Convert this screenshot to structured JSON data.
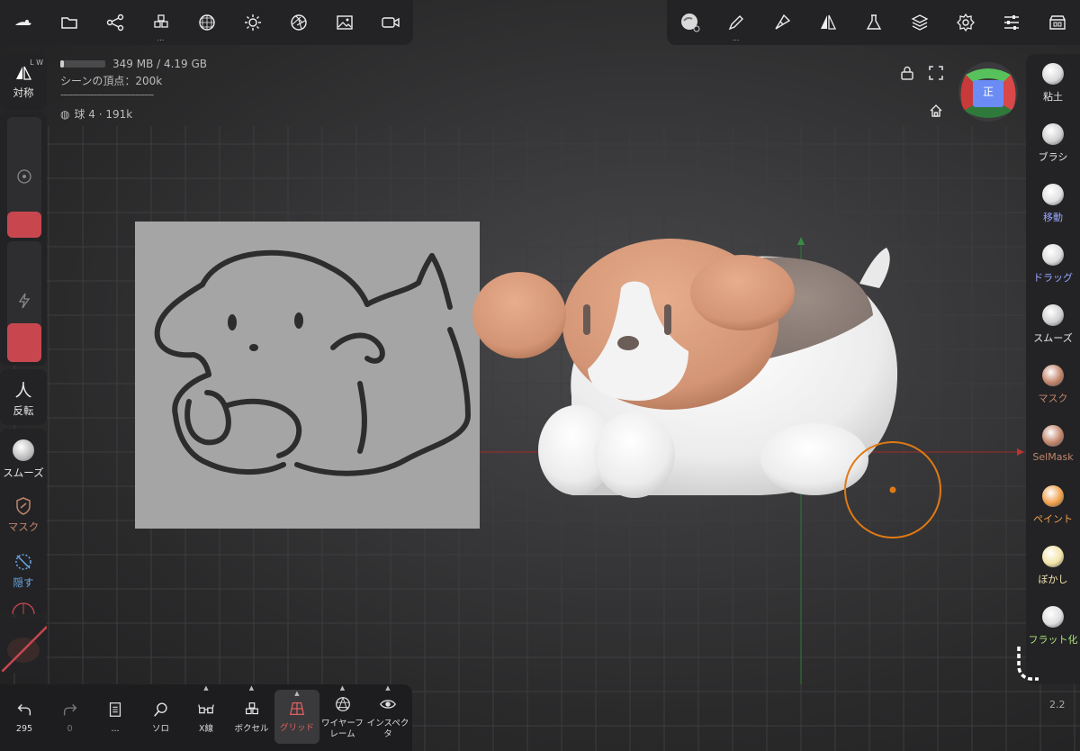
{
  "toolbar_left": [
    {
      "name": "logo-icon"
    },
    {
      "name": "folder-icon"
    },
    {
      "name": "scene-graph-icon"
    },
    {
      "name": "voxel-icon",
      "has_dots": true
    },
    {
      "name": "topology-icon"
    },
    {
      "name": "light-icon"
    },
    {
      "name": "aperture-icon"
    },
    {
      "name": "image-icon"
    },
    {
      "name": "video-icon"
    }
  ],
  "toolbar_right": [
    {
      "name": "material-sphere-icon"
    },
    {
      "name": "pen-icon",
      "has_dots": true
    },
    {
      "name": "brush-icon"
    },
    {
      "name": "symmetry-icon"
    },
    {
      "name": "flask-icon"
    },
    {
      "name": "layers-icon"
    },
    {
      "name": "settings-gear-icon"
    },
    {
      "name": "sliders-icon"
    },
    {
      "name": "shop-icon"
    }
  ],
  "stats": {
    "memory": "349 MB / 4.19 GB",
    "memory_fraction": 0.08,
    "vertices": "シーンの頂点：200k",
    "divider": "-------------------------------",
    "object": "球 4 · 191k"
  },
  "left_panel": {
    "symmetry_label": "対称",
    "symmetry_badge": "L W",
    "radius_fraction": 0.22,
    "intensity_fraction": 0.32,
    "invert_label": "反転",
    "smooth_label": "スムーズ",
    "mask_label": "マスク",
    "hide_label": "隠す"
  },
  "right_panel": [
    {
      "label": "粘土",
      "color": "#e6e6e6",
      "ball": "#d9d9d9"
    },
    {
      "label": "ブラシ",
      "color": "#e6e6e6",
      "ball": "#d0d0d0"
    },
    {
      "label": "移動",
      "color": "#9aa6ff",
      "ball": "#e0e0e0"
    },
    {
      "label": "ドラッグ",
      "color": "#9aa6ff",
      "ball": "#dcdcdc"
    },
    {
      "label": "スムーズ",
      "color": "#e6e6e6",
      "ball": "#cfcfcf"
    },
    {
      "label": "マスク",
      "color": "#c1846a",
      "ball": "#c1846a"
    },
    {
      "label": "SelMask",
      "color": "#c1846a",
      "ball": "#c1846a"
    },
    {
      "label": "ペイント",
      "color": "#f0a04b",
      "ball": "#f0a04b"
    },
    {
      "label": "ぼかし",
      "color": "#f0e0b0",
      "ball": "#f2e3a6"
    },
    {
      "label": "フラット化",
      "color": "#a8e07a",
      "ball": "#dddddd"
    }
  ],
  "gizmo": {
    "label": "正"
  },
  "version": "2.2",
  "bottom_bar": [
    {
      "name": "undo-button",
      "icon": "undo-icon",
      "label": "295",
      "color": "#dddddd"
    },
    {
      "name": "redo-button",
      "icon": "redo-icon",
      "label": "0",
      "color": "#777777"
    },
    {
      "name": "notes-button",
      "icon": "notes-icon",
      "label": "...",
      "color": "#dddddd"
    },
    {
      "name": "solo-button",
      "icon": "search-icon",
      "label": "ソロ",
      "color": "#dddddd",
      "caret": false
    },
    {
      "name": "xray-button",
      "icon": "glasses-icon",
      "label": "X線",
      "color": "#dddddd",
      "caret": true
    },
    {
      "name": "voxel-button",
      "icon": "voxel-icon",
      "label": "ボクセル",
      "color": "#dddddd",
      "caret": true
    },
    {
      "name": "grid-button",
      "icon": "grid-icon",
      "label": "グリッド",
      "color": "#e06060",
      "caret": true,
      "active": true
    },
    {
      "name": "wireframe-button",
      "icon": "wireframe-icon",
      "label": "ワイヤーフ\nレーム",
      "color": "#dddddd",
      "caret": true
    },
    {
      "name": "inspector-button",
      "icon": "eye-icon",
      "label": "インスペクタ",
      "color": "#dddddd",
      "caret": true
    }
  ]
}
